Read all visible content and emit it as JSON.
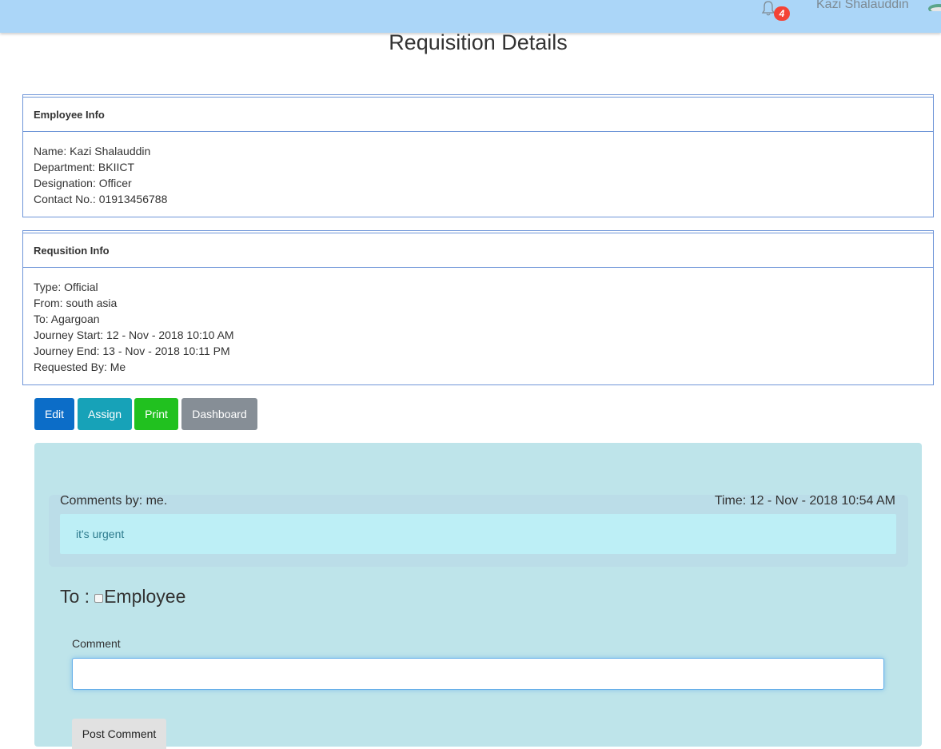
{
  "header": {
    "notification_count": "4",
    "user_name": "Kazi Shalauddin",
    "icons": {
      "notification": "bell-icon",
      "user": "user-avatar-icon"
    },
    "colors": {
      "bar": "#abd6f8",
      "badge": "#f44336"
    }
  },
  "page": {
    "title": "Requisition Details"
  },
  "employee_info": {
    "heading": "Employee Info",
    "lines": [
      "Name: Kazi Shalauddin",
      "Department: BKIICT",
      "Designation: Officer",
      "Contact No.: 01913456788"
    ]
  },
  "requisition_info": {
    "heading": "Requsition Info",
    "lines": [
      "Type: Official",
      "From: south asia",
      "To: Agargoan",
      "Journey Start: 12 - Nov - 2018 10:10 AM",
      "Journey End: 13 - Nov - 2018 10:11 PM",
      "Requested By: Me"
    ]
  },
  "actions": {
    "edit": "Edit",
    "assign": "Assign",
    "print": "Print",
    "dashboard": "Dashboard",
    "colors": {
      "edit": "#0c6dc8",
      "assign": "#17a2b8",
      "print": "#21c11f",
      "dashboard": "#868e96"
    }
  },
  "comments": {
    "items": [
      {
        "by": "Comments by: me.",
        "time": "Time: 12 - Nov - 2018 10:54 AM",
        "text": "it's urgent"
      }
    ]
  },
  "form": {
    "to_label": "To :",
    "recipient_option": "Employee",
    "recipient_checked": false,
    "comment_label": "Comment",
    "comment_value": "",
    "submit_label": "Post Comment"
  }
}
